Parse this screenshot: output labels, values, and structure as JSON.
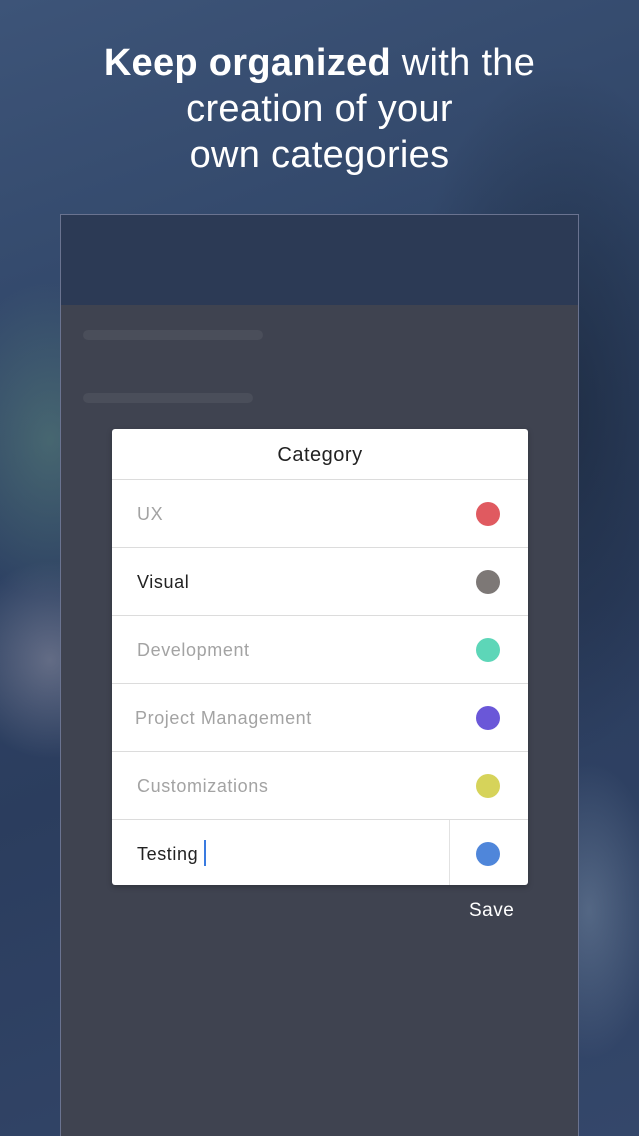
{
  "headline": {
    "bold": "Keep organized",
    "rest_line1": " with the",
    "line2": "creation of your",
    "line3": "own categories"
  },
  "dialog": {
    "title": "Category",
    "items": [
      {
        "label": "UX",
        "color": "#e05a60",
        "state": "muted"
      },
      {
        "label": "Visual",
        "color": "#7d7876",
        "state": "dark"
      },
      {
        "label": "Development",
        "color": "#5dd6b8",
        "state": "muted"
      },
      {
        "label": "Project Management",
        "color": "#6a57d8",
        "state": "muted"
      },
      {
        "label": "Customizations",
        "color": "#d6d35a",
        "state": "muted"
      },
      {
        "label": "Testing",
        "color": "#4f86da",
        "state": "editing"
      }
    ],
    "save_label": "Save"
  },
  "colors": {
    "background": "#2f4466",
    "device": "#3f4350",
    "caret": "#3a7be0"
  }
}
